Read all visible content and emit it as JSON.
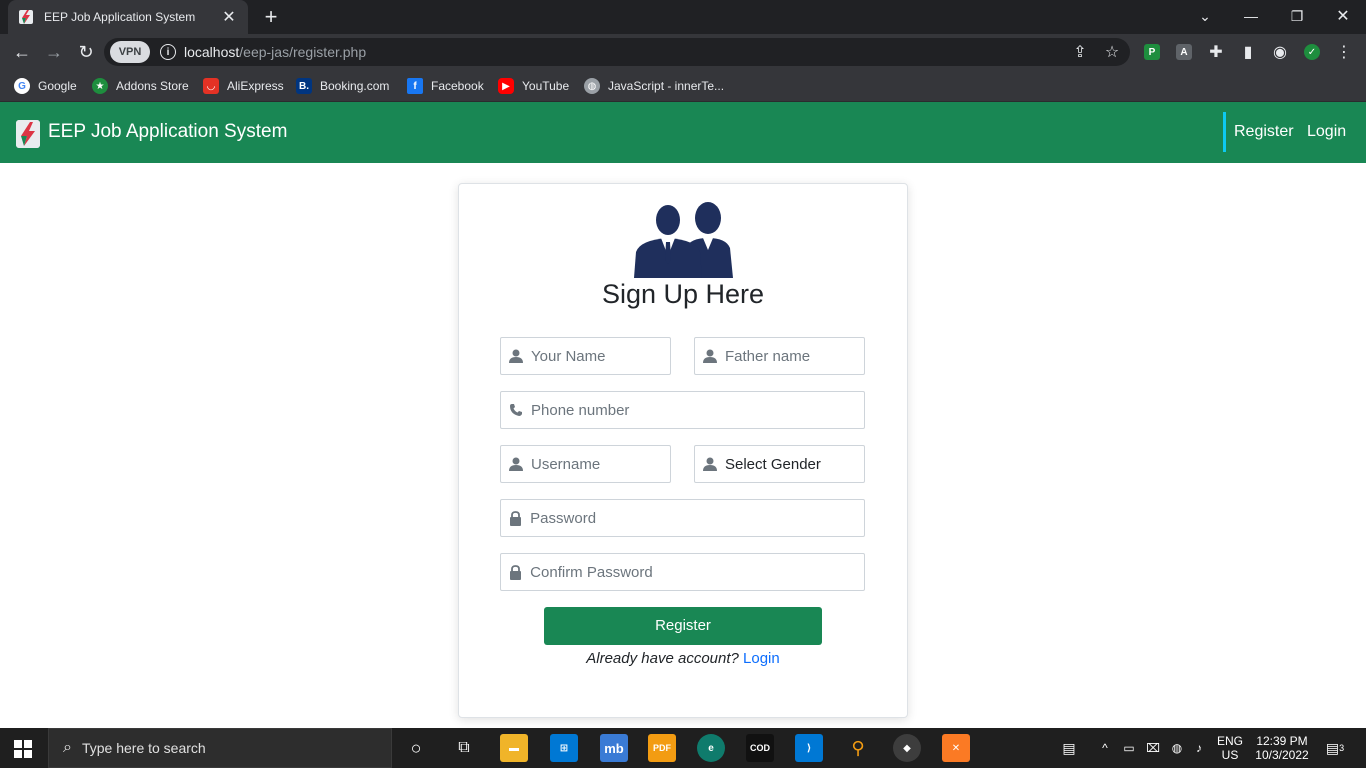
{
  "browser": {
    "tab_title": "EEP Job Application System",
    "tab_close": "✕",
    "new_tab": "+",
    "vpn_label": "VPN",
    "url_host": "localhost",
    "url_path": "/eep-jas/register.php"
  },
  "bookmarks": [
    {
      "label": "Google",
      "icon": "google-icon",
      "color": "#ffffff"
    },
    {
      "label": "Addons Store",
      "icon": "addons-icon",
      "color": "#1e8e3e"
    },
    {
      "label": "AliExpress",
      "icon": "aliexpress-icon",
      "color": "#e43225"
    },
    {
      "label": "Booking.com",
      "icon": "booking-icon",
      "color": "#003580"
    },
    {
      "label": "Facebook",
      "icon": "facebook-icon",
      "color": "#1877f2"
    },
    {
      "label": "YouTube",
      "icon": "youtube-icon",
      "color": "#ff0000"
    },
    {
      "label": "JavaScript - innerTe...",
      "icon": "globe-icon",
      "color": "#9aa0a6"
    }
  ],
  "navbar": {
    "brand": "EEP Job Application System",
    "links": [
      "Register",
      "Login"
    ],
    "bg_color": "#198754"
  },
  "form": {
    "title": "Sign Up Here",
    "name_placeholder": "Your Name",
    "father_placeholder": "Father name",
    "phone_placeholder": "Phone number",
    "username_placeholder": "Username",
    "gender_value": "Select Gender",
    "password_placeholder": "Password",
    "confirm_placeholder": "Confirm Password",
    "submit_label": "Register",
    "login_prompt": "Already have account?",
    "login_link": "Login"
  },
  "taskbar": {
    "search_placeholder": "Type here to search",
    "lang_top": "ENG",
    "lang_bottom": "US",
    "time": "12:39 PM",
    "date": "10/3/2022",
    "notification_count": "3"
  }
}
